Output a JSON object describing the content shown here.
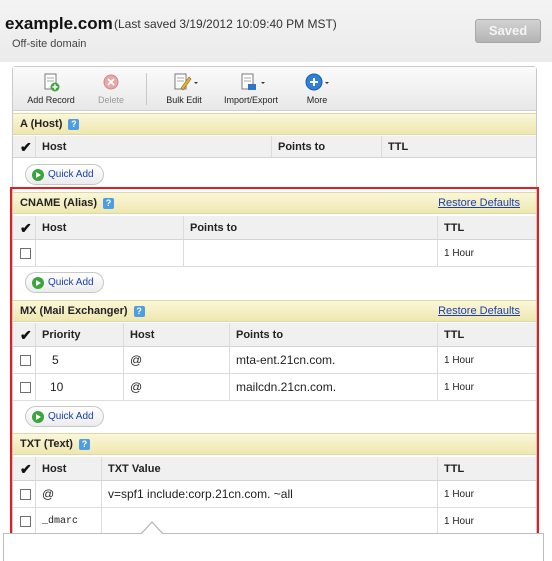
{
  "header": {
    "domain": "example.com",
    "saved_info": "(Last saved 3/19/2012 10:09:40 PM MST)",
    "subtitle": "Off-site domain",
    "saved_button": "Saved"
  },
  "toolbar": {
    "add_record": "Add Record",
    "delete": "Delete",
    "bulk_edit": "Bulk Edit",
    "import_export": "Import/Export",
    "more": "More"
  },
  "help_glyph": "?",
  "a_section": {
    "title": "A (Host)",
    "columns": {
      "host": "Host",
      "points_to": "Points to",
      "ttl": "TTL"
    },
    "quick_add": "Quick Add"
  },
  "cname_section": {
    "title": "CNAME (Alias)",
    "restore": "Restore Defaults",
    "columns": {
      "host": "Host",
      "points_to": "Points to",
      "ttl": "TTL"
    },
    "rows": [
      {
        "host": "",
        "points_to": "",
        "ttl": "1 Hour"
      }
    ],
    "quick_add": "Quick Add"
  },
  "mx_section": {
    "title": "MX (Mail Exchanger)",
    "restore": "Restore Defaults",
    "columns": {
      "priority": "Priority",
      "host": "Host",
      "points_to": "Points to",
      "ttl": "TTL"
    },
    "rows": [
      {
        "priority": "5",
        "host": "@",
        "points_to": "mta-ent.21cn.com.",
        "ttl": "1 Hour"
      },
      {
        "priority": "10",
        "host": "@",
        "points_to": "mailcdn.21cn.com.",
        "ttl": "1 Hour"
      }
    ],
    "quick_add": "Quick Add"
  },
  "txt_section": {
    "title": "TXT (Text)",
    "columns": {
      "host": "Host",
      "txt_value": "TXT Value",
      "ttl": "TTL"
    },
    "rows": [
      {
        "host": "@",
        "txt_value": "v=spf1 include:corp.21cn.com. ~all",
        "ttl": "1 Hour"
      },
      {
        "host": "_dmarc",
        "txt_value": "",
        "ttl": "1 Hour"
      }
    ]
  },
  "colors": {
    "highlight": "#e02020",
    "section_header": "#f4efc4",
    "link": "#1a3fae"
  }
}
